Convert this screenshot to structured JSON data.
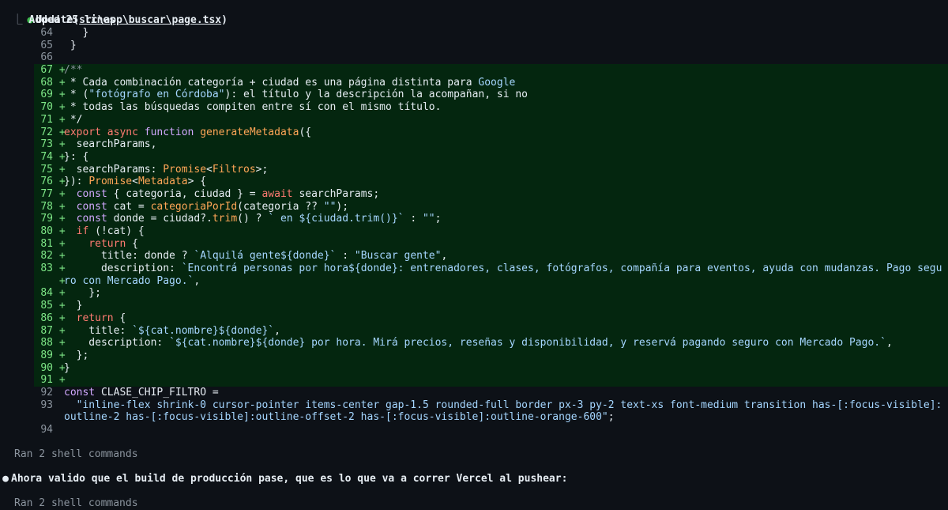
{
  "tool_call": {
    "name": "Update",
    "arg": "src\\app\\buscar\\page.tsx",
    "summary_prefix": "⎿",
    "summary": "Added 25 lines"
  },
  "diff": [
    {
      "n": "64",
      "t": "ctx",
      "segs": [
        {
          "c": "code",
          "v": "   }"
        }
      ]
    },
    {
      "n": "65",
      "t": "ctx",
      "segs": [
        {
          "c": "code",
          "v": " }"
        }
      ]
    },
    {
      "n": "66",
      "t": "ctx",
      "segs": [
        {
          "c": "code",
          "v": ""
        }
      ]
    },
    {
      "n": "67",
      "t": "add",
      "segs": [
        {
          "c": "c",
          "v": "/**"
        }
      ]
    },
    {
      "n": "68",
      "t": "add",
      "segs": [
        {
          "c": "code",
          "v": " * Cada combinación categoría + ciudad es una página distinta para "
        },
        {
          "c": "s",
          "v": "Google"
        }
      ]
    },
    {
      "n": "69",
      "t": "add",
      "segs": [
        {
          "c": "code",
          "v": " * ("
        },
        {
          "c": "s",
          "v": "\"fotógrafo en Córdoba\""
        },
        {
          "c": "code",
          "v": "): el título y la descripción la acompañan, si no"
        }
      ]
    },
    {
      "n": "70",
      "t": "add",
      "segs": [
        {
          "c": "code",
          "v": " * todas las búsquedas compiten entre sí con el mismo título."
        }
      ]
    },
    {
      "n": "71",
      "t": "add",
      "segs": [
        {
          "c": "code",
          "v": " */"
        }
      ]
    },
    {
      "n": "72",
      "t": "add",
      "segs": [
        {
          "c": "k",
          "v": "export async "
        },
        {
          "c": "f",
          "v": "function "
        },
        {
          "c": "t",
          "v": "generateMetadata"
        },
        {
          "c": "code",
          "v": "({"
        }
      ]
    },
    {
      "n": "73",
      "t": "add",
      "segs": [
        {
          "c": "code",
          "v": "  searchParams,"
        }
      ]
    },
    {
      "n": "74",
      "t": "add",
      "segs": [
        {
          "c": "code",
          "v": "}: {"
        }
      ]
    },
    {
      "n": "75",
      "t": "add",
      "segs": [
        {
          "c": "code",
          "v": "  searchParams: "
        },
        {
          "c": "t",
          "v": "Promise"
        },
        {
          "c": "code",
          "v": "<"
        },
        {
          "c": "t",
          "v": "Filtros"
        },
        {
          "c": "code",
          "v": ">;"
        }
      ]
    },
    {
      "n": "76",
      "t": "add",
      "segs": [
        {
          "c": "code",
          "v": "}): "
        },
        {
          "c": "t",
          "v": "Promise"
        },
        {
          "c": "code",
          "v": "<"
        },
        {
          "c": "t",
          "v": "Metadata"
        },
        {
          "c": "code",
          "v": "> {"
        }
      ]
    },
    {
      "n": "77",
      "t": "add",
      "segs": [
        {
          "c": "f",
          "v": "  const "
        },
        {
          "c": "code",
          "v": "{ categoria, ciudad } = "
        },
        {
          "c": "k",
          "v": "await "
        },
        {
          "c": "code",
          "v": "searchParams;"
        }
      ]
    },
    {
      "n": "78",
      "t": "add",
      "segs": [
        {
          "c": "f",
          "v": "  const "
        },
        {
          "c": "code",
          "v": "cat = "
        },
        {
          "c": "t",
          "v": "categoriaPorId"
        },
        {
          "c": "code",
          "v": "(categoria ?? "
        },
        {
          "c": "s",
          "v": "\"\""
        },
        {
          "c": "code",
          "v": ");"
        }
      ]
    },
    {
      "n": "79",
      "t": "add",
      "segs": [
        {
          "c": "f",
          "v": "  const "
        },
        {
          "c": "code",
          "v": "donde = ciudad?."
        },
        {
          "c": "t",
          "v": "trim"
        },
        {
          "c": "code",
          "v": "() ? "
        },
        {
          "c": "s",
          "v": "` en ${ciudad.trim()}`"
        },
        {
          "c": "code",
          "v": " : "
        },
        {
          "c": "s",
          "v": "\"\""
        },
        {
          "c": "code",
          "v": ";"
        }
      ]
    },
    {
      "n": "80",
      "t": "add",
      "segs": [
        {
          "c": "k",
          "v": "  if "
        },
        {
          "c": "code",
          "v": "(!cat) {"
        }
      ]
    },
    {
      "n": "81",
      "t": "add",
      "segs": [
        {
          "c": "k",
          "v": "    return "
        },
        {
          "c": "code",
          "v": "{"
        }
      ]
    },
    {
      "n": "82",
      "t": "add",
      "segs": [
        {
          "c": "code",
          "v": "      title: donde ? "
        },
        {
          "c": "s",
          "v": "`Alquilá gente${donde}`"
        },
        {
          "c": "code",
          "v": " : "
        },
        {
          "c": "s",
          "v": "\"Buscar gente\""
        },
        {
          "c": "code",
          "v": ","
        }
      ]
    },
    {
      "n": "83",
      "t": "add",
      "segs": [
        {
          "c": "code",
          "v": "      description: "
        },
        {
          "c": "s",
          "v": "`Encontrá personas por hora${donde}: entrenadores, clases, fotógrafos, compañía para eventos, ayuda con mudanzas. Pago segu"
        }
      ]
    },
    {
      "n": "",
      "t": "add",
      "segs": [
        {
          "c": "s",
          "v": "ro con Mercado Pago.`"
        },
        {
          "c": "code",
          "v": ","
        }
      ]
    },
    {
      "n": "84",
      "t": "add",
      "segs": [
        {
          "c": "code",
          "v": "    };"
        }
      ]
    },
    {
      "n": "85",
      "t": "add",
      "segs": [
        {
          "c": "code",
          "v": "  }"
        }
      ]
    },
    {
      "n": "86",
      "t": "add",
      "segs": [
        {
          "c": "k",
          "v": "  return "
        },
        {
          "c": "code",
          "v": "{"
        }
      ]
    },
    {
      "n": "87",
      "t": "add",
      "segs": [
        {
          "c": "code",
          "v": "    title: "
        },
        {
          "c": "s",
          "v": "`${cat.nombre}${donde}`"
        },
        {
          "c": "code",
          "v": ","
        }
      ]
    },
    {
      "n": "88",
      "t": "add",
      "segs": [
        {
          "c": "code",
          "v": "    description: "
        },
        {
          "c": "s",
          "v": "`${cat.nombre}${donde} por hora. Mirá precios, reseñas y disponibilidad, y reservá pagando seguro con Mercado Pago.`"
        },
        {
          "c": "code",
          "v": ","
        }
      ]
    },
    {
      "n": "89",
      "t": "add",
      "segs": [
        {
          "c": "code",
          "v": "  };"
        }
      ]
    },
    {
      "n": "90",
      "t": "add",
      "segs": [
        {
          "c": "code",
          "v": "}"
        }
      ]
    },
    {
      "n": "91",
      "t": "add",
      "segs": [
        {
          "c": "code",
          "v": ""
        }
      ]
    },
    {
      "n": "92",
      "t": "ctx",
      "segs": [
        {
          "c": "f",
          "v": "const "
        },
        {
          "c": "code",
          "v": "CLASE_CHIP_FILTRO ="
        }
      ]
    },
    {
      "n": "93",
      "t": "ctx",
      "segs": [
        {
          "c": "s",
          "v": "  \"inline-flex shrink-0 cursor-pointer items-center gap-1.5 rounded-full border px-3 py-2 text-xs font-medium transition has-[:focus-visible]:"
        }
      ]
    },
    {
      "n": "",
      "t": "ctx",
      "segs": [
        {
          "c": "s",
          "v": "outline-2 has-[:focus-visible]:outline-offset-2 has-[:focus-visible]:outline-orange-600\""
        },
        {
          "c": "code",
          "v": ";"
        }
      ]
    },
    {
      "n": "94",
      "t": "ctx",
      "segs": [
        {
          "c": "code",
          "v": ""
        }
      ]
    }
  ],
  "ran1": "Ran 2 shell commands",
  "message": "Ahora valido que el build de producción pase, que es lo que va a correr Vercel al pushear:",
  "ran2": "Ran 2 shell commands",
  "colors": {
    "background": "#0d1117",
    "added_bg": "#04260f",
    "added_fg": "#7ee787",
    "bullet_green": "#3fb950"
  }
}
